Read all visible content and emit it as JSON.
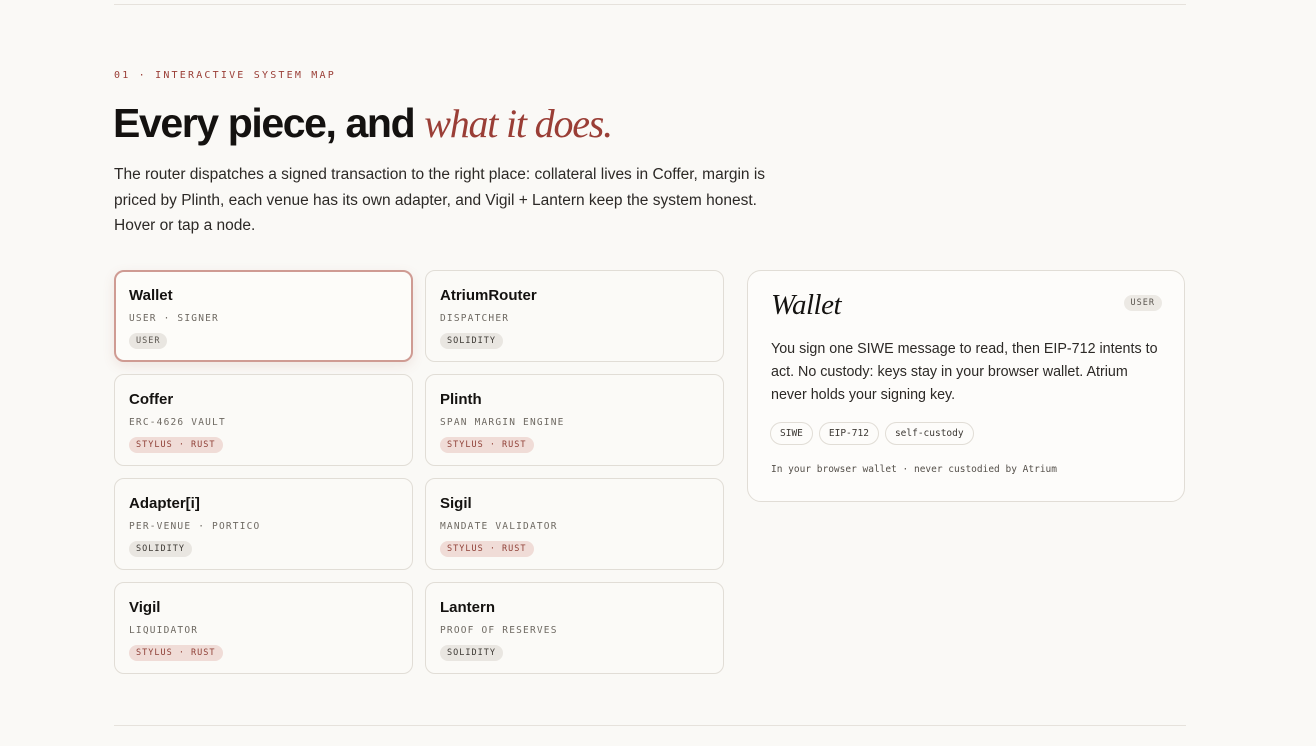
{
  "section": {
    "eyebrow": "01 · INTERACTIVE SYSTEM MAP",
    "headline_main": "Every piece, and ",
    "headline_accent": "what it does.",
    "intro": "The router dispatches a signed transaction to the right place: collateral lives in Coffer, margin is priced by Plinth, each venue has its own adapter, and Vigil + Lantern keep the system honest. Hover or tap a node."
  },
  "nodes": [
    {
      "title": "Wallet",
      "role": "USER · SIGNER",
      "tag": "USER",
      "tag_kind": "user",
      "active": true
    },
    {
      "title": "AtriumRouter",
      "role": "DISPATCHER",
      "tag": "SOLIDITY",
      "tag_kind": "sol"
    },
    {
      "title": "Coffer",
      "role": "ERC-4626 VAULT",
      "tag": "STYLUS · RUST",
      "tag_kind": "rust"
    },
    {
      "title": "Plinth",
      "role": "SPAN MARGIN ENGINE",
      "tag": "STYLUS · RUST",
      "tag_kind": "rust"
    },
    {
      "title": "Adapter[i]",
      "role": "PER-VENUE · PORTICO",
      "tag": "SOLIDITY",
      "tag_kind": "sol"
    },
    {
      "title": "Sigil",
      "role": "MANDATE VALIDATOR",
      "tag": "STYLUS · RUST",
      "tag_kind": "rust"
    },
    {
      "title": "Vigil",
      "role": "LIQUIDATOR",
      "tag": "STYLUS · RUST",
      "tag_kind": "rust"
    },
    {
      "title": "Lantern",
      "role": "PROOF OF RESERVES",
      "tag": "SOLIDITY",
      "tag_kind": "sol"
    }
  ],
  "detail": {
    "title": "Wallet",
    "badge": "USER",
    "description": "You sign one SIWE message to read, then EIP-712 intents to act. No custody: keys stay in your browser wallet. Atrium never holds your signing key.",
    "chips": [
      "SIWE",
      "EIP-712",
      "self-custody"
    ],
    "footer": "In your browser wallet · never custodied by Atrium"
  }
}
